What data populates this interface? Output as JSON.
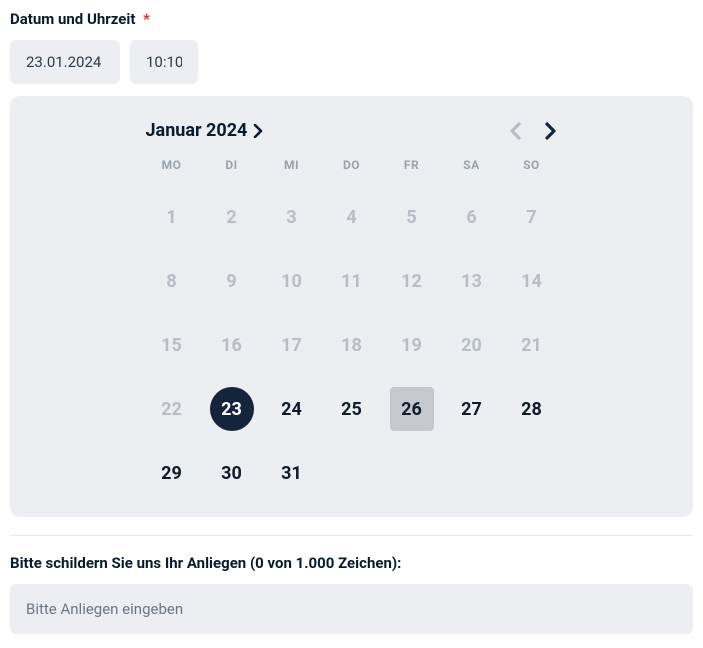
{
  "datetime": {
    "label": "Datum und Uhrzeit",
    "required_marker": "*",
    "date_value": "23.01.2024",
    "time_value": "10:10"
  },
  "calendar": {
    "month_label": "Januar 2024",
    "dow": [
      "MO",
      "DI",
      "MI",
      "DO",
      "FR",
      "SA",
      "SO"
    ],
    "days": [
      {
        "n": "1",
        "disabled": true
      },
      {
        "n": "2",
        "disabled": true
      },
      {
        "n": "3",
        "disabled": true
      },
      {
        "n": "4",
        "disabled": true
      },
      {
        "n": "5",
        "disabled": true
      },
      {
        "n": "6",
        "disabled": true
      },
      {
        "n": "7",
        "disabled": true
      },
      {
        "n": "8",
        "disabled": true
      },
      {
        "n": "9",
        "disabled": true
      },
      {
        "n": "10",
        "disabled": true
      },
      {
        "n": "11",
        "disabled": true
      },
      {
        "n": "12",
        "disabled": true
      },
      {
        "n": "13",
        "disabled": true
      },
      {
        "n": "14",
        "disabled": true
      },
      {
        "n": "15",
        "disabled": true
      },
      {
        "n": "16",
        "disabled": true
      },
      {
        "n": "17",
        "disabled": true
      },
      {
        "n": "18",
        "disabled": true
      },
      {
        "n": "19",
        "disabled": true
      },
      {
        "n": "20",
        "disabled": true
      },
      {
        "n": "21",
        "disabled": true
      },
      {
        "n": "22",
        "disabled": true
      },
      {
        "n": "23",
        "disabled": false,
        "selected": true
      },
      {
        "n": "24",
        "disabled": false
      },
      {
        "n": "25",
        "disabled": false
      },
      {
        "n": "26",
        "disabled": false,
        "today": true
      },
      {
        "n": "27",
        "disabled": false
      },
      {
        "n": "28",
        "disabled": false
      },
      {
        "n": "29",
        "disabled": false
      },
      {
        "n": "30",
        "disabled": false
      },
      {
        "n": "31",
        "disabled": false
      }
    ]
  },
  "concern": {
    "label": "Bitte schildern Sie uns Ihr Anliegen (0 von 1.000 Zeichen):",
    "placeholder": "Bitte Anliegen eingeben"
  },
  "colors": {
    "selected_bg": "#14243c",
    "panel_bg": "#eceef1",
    "disabled_text": "#b8bec6"
  }
}
